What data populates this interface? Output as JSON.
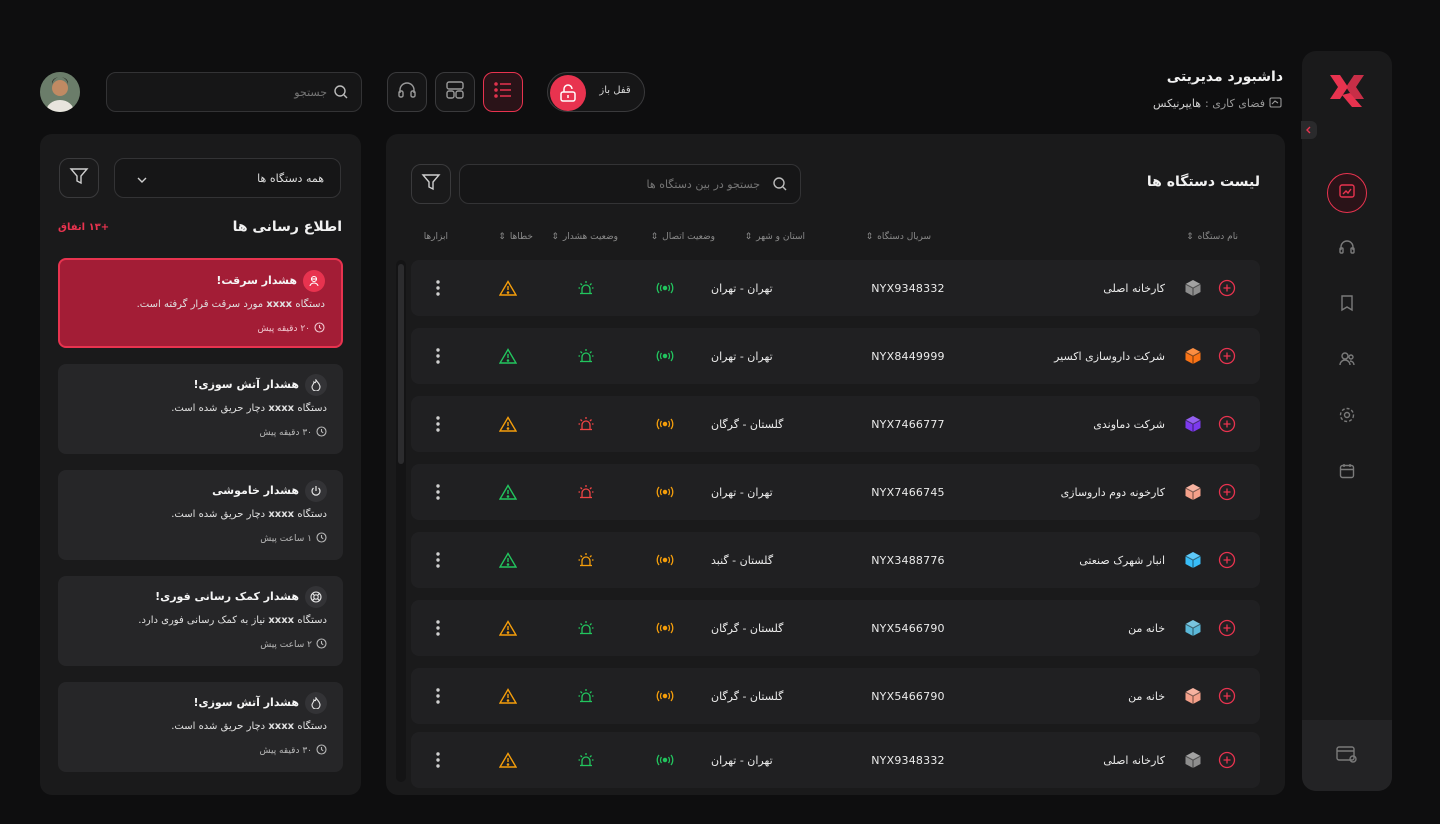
{
  "header": {
    "title": "داشبورد مدیریتی",
    "workspace_label": "فضای کاری :",
    "workspace_name": "هایپرنیکس",
    "lock_label": "قفل باز",
    "search_placeholder": "جستجو"
  },
  "colors": {
    "accent": "#e8334f",
    "green": "#22c55e",
    "orange": "#f59e0b",
    "red": "#ef4444"
  },
  "sidebar": {
    "icons": [
      "chart-icon",
      "headset-icon",
      "book-icon",
      "users-icon",
      "gear-icon",
      "calendar-icon"
    ],
    "active": "chart-icon",
    "bottom_icon": "wallet-settings-icon"
  },
  "device_list": {
    "title": "لیست دستگاه ها",
    "search_placeholder": "جستجو در بین دستگاه ها",
    "columns": {
      "name": "نام دستگاه",
      "serial": "سریال دستگاه",
      "city": "استان و شهر",
      "connection": "وضعیت اتصال",
      "alarm": "وضعیت هشدار",
      "errors": "خطاها",
      "tools": "ابزارها"
    },
    "rows": [
      {
        "name": "کارخانه اصلی",
        "cube": "#8d8d8d",
        "serial": "NYX9348332",
        "city": "تهران - تهران",
        "conn": "green",
        "alarm": "green",
        "err": "orange"
      },
      {
        "name": "شرکت داروسازی اکسیر",
        "cube": "#f97316",
        "serial": "NYX8449999",
        "city": "تهران - تهران",
        "conn": "green",
        "alarm": "green",
        "err": "green"
      },
      {
        "name": "شرکت دماوندی",
        "cube": "#7c3aed",
        "serial": "NYX7466777",
        "city": "گلستان - گرگان",
        "conn": "orange",
        "alarm": "red",
        "err": "orange"
      },
      {
        "name": "کارخونه دوم داروسازی",
        "cube": "#f4a08a",
        "serial": "NYX7466745",
        "city": "تهران - تهران",
        "conn": "orange",
        "alarm": "red",
        "err": "green"
      },
      {
        "name": "انبار شهرک صنعتی",
        "cube": "#38bdf8",
        "serial": "NYX3488776",
        "city": "گلستان - گنبد",
        "conn": "orange",
        "alarm": "orange",
        "err": "green"
      },
      {
        "name": "خانه من",
        "cube": "#5bb8d8",
        "serial": "NYX5466790",
        "city": "گلستان - گرگان",
        "conn": "orange",
        "alarm": "green",
        "err": "orange"
      },
      {
        "name": "خانه من",
        "cube": "#f4a08a",
        "serial": "NYX5466790",
        "city": "گلستان - گرگان",
        "conn": "orange",
        "alarm": "green",
        "err": "orange"
      },
      {
        "name": "کارخانه اصلی",
        "cube": "#8d8d8d",
        "serial": "NYX9348332",
        "city": "تهران - تهران",
        "conn": "green",
        "alarm": "green",
        "err": "orange"
      }
    ]
  },
  "notifications": {
    "select_value": "همه دستگاه ها",
    "heading": "اطلاع رسانی ها",
    "count": "+۱۳ اتفاق",
    "items": [
      {
        "title": "هشدار سرقت!",
        "device": "xxxx",
        "prefix": "دستگاه",
        "body": "مورد سرقت قرار گرفته است.",
        "time": "۲۰ دقیقه پیش",
        "icon": "thief-icon",
        "alert": true
      },
      {
        "title": "هشدار آتش سوزی!",
        "device": "xxxx",
        "prefix": "دستگاه",
        "body": "دچار حریق شده است.",
        "time": "۳۰ دقیقه پیش",
        "icon": "fire-icon",
        "alert": false
      },
      {
        "title": "هشدار خاموشی",
        "device": "xxxx",
        "prefix": "دستگاه",
        "body": "دچار حریق شده است.",
        "time": "۱ ساعت پیش",
        "icon": "power-icon",
        "alert": false
      },
      {
        "title": "هشدار کمک رسانی فوری!",
        "device": "xxxx",
        "prefix": "دستگاه",
        "body": "نیاز به کمک رسانی فوری دارد.",
        "time": "۲ ساعت پیش",
        "icon": "lifebuoy-icon",
        "alert": false
      },
      {
        "title": "هشدار آتش سوزی!",
        "device": "xxxx",
        "prefix": "دستگاه",
        "body": "دچار حریق شده است.",
        "time": "۳۰ دقیقه پیش",
        "icon": "fire-icon",
        "alert": false
      }
    ]
  }
}
